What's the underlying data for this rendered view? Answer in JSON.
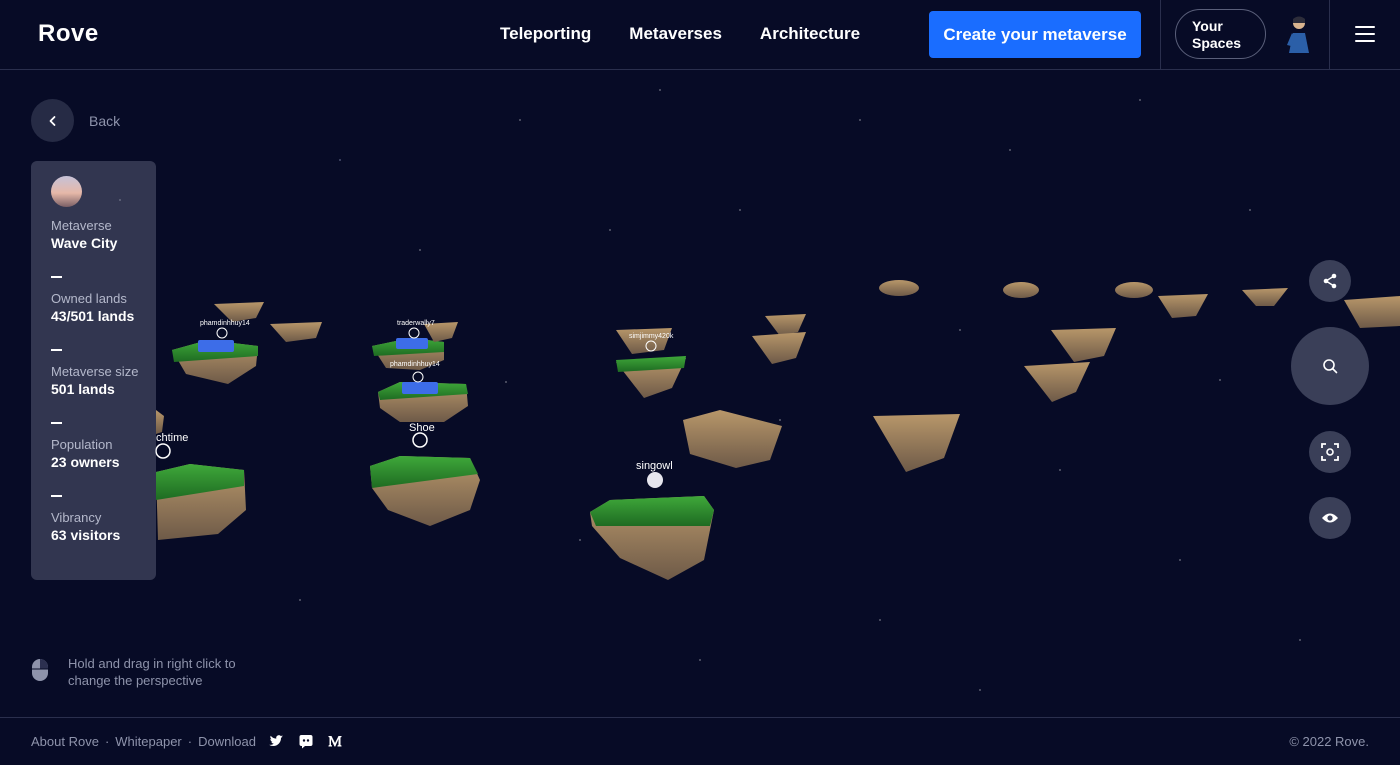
{
  "header": {
    "logo": "Rove",
    "nav": [
      "Teleporting",
      "Metaverses",
      "Architecture"
    ],
    "cta_label": "Create your metaverse",
    "spaces_label_line1": "Your",
    "spaces_label_line2": "Spaces"
  },
  "back_label": "Back",
  "panel": {
    "metaverse_label": "Metaverse",
    "metaverse_name": "Wave City",
    "stats": [
      {
        "label": "Owned lands",
        "value": "43/501 lands"
      },
      {
        "label": "Metaverse size",
        "value": "501 lands"
      },
      {
        "label": "Population",
        "value": "23 owners"
      },
      {
        "label": "Vibrancy",
        "value": "63 visitors"
      }
    ]
  },
  "scene_labels": {
    "shoe": "Shoe",
    "singowl": "singowl",
    "chtime": "chtime",
    "phamdinhhuy14_a": "phamdinhhuy14",
    "phamdinhhuy14_b": "phamdinhhuy14",
    "traderwally": "traderwally7",
    "simjimmy": "simjimmy420k"
  },
  "tools": [
    "share-icon",
    "search-icon",
    "focus-icon",
    "eye-icon"
  ],
  "hint": "Hold and drag in right click to change the perspective",
  "footer": {
    "links": [
      "About Rove",
      "Whitepaper",
      "Download"
    ],
    "separator": "·",
    "copyright": "© 2022 Rove."
  },
  "colors": {
    "background": "#070b26",
    "cta": "#1a6dff",
    "grass": "#2f8a2a",
    "rock": "#a88a5a"
  }
}
